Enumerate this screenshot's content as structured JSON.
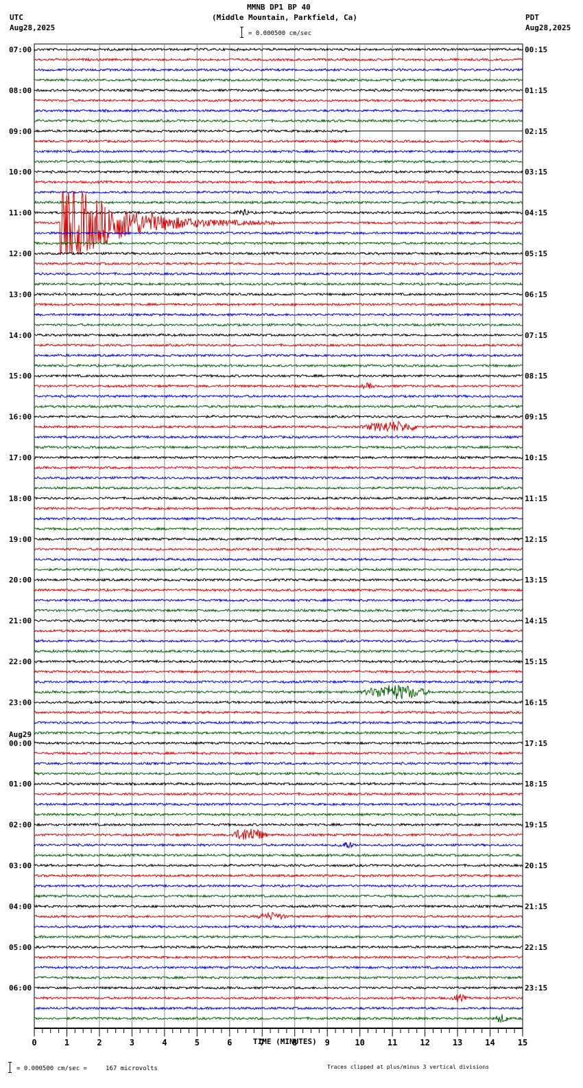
{
  "header": {
    "title": "MMNB DP1 BP 40",
    "subtitle": "(Middle Mountain, Parkfield, Ca)",
    "left_tz": "UTC",
    "left_date": "Aug28,2025",
    "right_tz": "PDT",
    "right_date": "Aug28,2025",
    "scale_text": "= 0.000500 cm/sec"
  },
  "footer": {
    "scale_text": "= 0.000500 cm/sec =     167 microvolts",
    "clip_note": "Traces clipped at plus/minus 3 vertical divisions"
  },
  "chart_data": {
    "type": "line",
    "subtype": "helicorder-seismogram",
    "xlabel": "TIME (MINUTES)",
    "xlim": [
      0,
      15
    ],
    "x_ticks": [
      "0",
      "1",
      "2",
      "3",
      "4",
      "5",
      "6",
      "7",
      "8",
      "9",
      "10",
      "11",
      "12",
      "13",
      "14",
      "15"
    ],
    "traces_per_hour": 4,
    "trace_colors": [
      "#000000",
      "#e00000",
      "#0000e0",
      "#006000"
    ],
    "left_labels": [
      "07:00",
      "08:00",
      "09:00",
      "10:00",
      "11:00",
      "12:00",
      "13:00",
      "14:00",
      "15:00",
      "16:00",
      "17:00",
      "18:00",
      "19:00",
      "20:00",
      "21:00",
      "22:00",
      "23:00",
      "00:00",
      "01:00",
      "02:00",
      "03:00",
      "04:00",
      "05:00",
      "06:00"
    ],
    "date_change_label": "Aug29",
    "right_labels": [
      "00:15",
      "01:15",
      "02:15",
      "03:15",
      "04:15",
      "05:15",
      "06:15",
      "07:15",
      "08:15",
      "09:15",
      "10:15",
      "11:15",
      "12:15",
      "13:15",
      "14:15",
      "15:15",
      "16:15",
      "17:15",
      "18:15",
      "19:15",
      "20:15",
      "21:15",
      "22:15",
      "23:15"
    ],
    "clip_divisions": 3,
    "events": [
      {
        "trace": 16,
        "start_min": 6.2,
        "duration_min": 0.4,
        "amplitude_div": 0.35
      },
      {
        "trace": 17,
        "start_min": 0.8,
        "duration_min": 5.5,
        "amplitude_div": 3.0
      },
      {
        "trace": 33,
        "start_min": 10.0,
        "duration_min": 0.5,
        "amplitude_div": 0.2
      },
      {
        "trace": 37,
        "start_min": 10.0,
        "duration_min": 2.0,
        "amplitude_div": 0.45
      },
      {
        "trace": 63,
        "start_min": 10.0,
        "duration_min": 2.2,
        "amplitude_div": 0.65
      },
      {
        "trace": 77,
        "start_min": 6.0,
        "duration_min": 1.2,
        "amplitude_div": 0.6
      },
      {
        "trace": 78,
        "start_min": 9.3,
        "duration_min": 0.6,
        "amplitude_div": 0.25
      },
      {
        "trace": 85,
        "start_min": 6.8,
        "duration_min": 1.0,
        "amplitude_div": 0.3
      },
      {
        "trace": 93,
        "start_min": 12.8,
        "duration_min": 0.5,
        "amplitude_div": 0.3
      },
      {
        "trace": 95,
        "start_min": 14.1,
        "duration_min": 0.5,
        "amplitude_div": 0.35
      }
    ],
    "gap": {
      "trace": 8,
      "flat_from_min": 9.75
    }
  }
}
